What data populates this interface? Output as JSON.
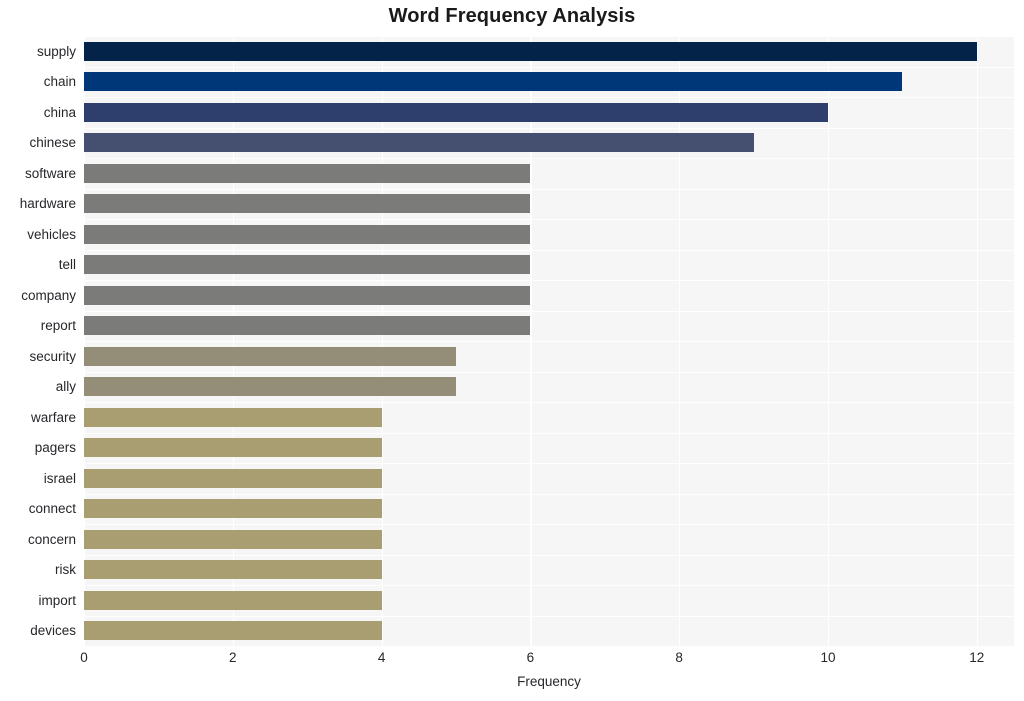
{
  "chart_data": {
    "type": "bar",
    "orientation": "horizontal",
    "title": "Word Frequency Analysis",
    "xlabel": "Frequency",
    "ylabel": "",
    "categories": [
      "supply",
      "chain",
      "china",
      "chinese",
      "software",
      "hardware",
      "vehicles",
      "tell",
      "company",
      "report",
      "security",
      "ally",
      "warfare",
      "pagers",
      "israel",
      "connect",
      "concern",
      "risk",
      "import",
      "devices"
    ],
    "values": [
      12,
      11,
      10,
      9,
      6,
      6,
      6,
      6,
      6,
      6,
      5,
      5,
      4,
      4,
      4,
      4,
      4,
      4,
      4,
      4
    ],
    "bar_colors": [
      "#032349",
      "#003778",
      "#2e3f6e",
      "#454f70",
      "#7b7b7a",
      "#7b7b7a",
      "#7b7b7a",
      "#7b7b7a",
      "#7b7b7a",
      "#7b7b7a",
      "#948d77",
      "#948d77",
      "#a89e71",
      "#a89e71",
      "#a89e71",
      "#a89e71",
      "#a89e71",
      "#a89e71",
      "#a89e71",
      "#a89e71"
    ],
    "xlim": [
      0,
      12.5
    ],
    "xticks": [
      0,
      2,
      4,
      6,
      8,
      10,
      12
    ],
    "xtick_labels": [
      "0",
      "2",
      "4",
      "6",
      "8",
      "10",
      "12"
    ],
    "grid": true,
    "grid_color": "#ffffff",
    "plot_background": "#f6f6f7",
    "legend": null
  }
}
